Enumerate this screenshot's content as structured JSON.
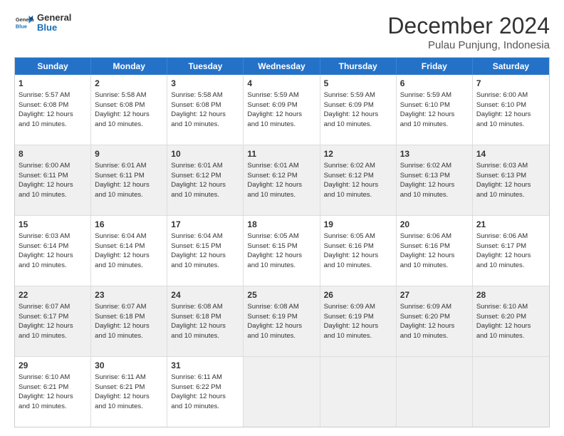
{
  "logo": {
    "line1": "General",
    "line2": "Blue"
  },
  "title": "December 2024",
  "subtitle": "Pulau Punjung, Indonesia",
  "days_of_week": [
    "Sunday",
    "Monday",
    "Tuesday",
    "Wednesday",
    "Thursday",
    "Friday",
    "Saturday"
  ],
  "rows": [
    [
      {
        "day": "1",
        "info": "Sunrise: 5:57 AM\nSunset: 6:08 PM\nDaylight: 12 hours\nand 10 minutes."
      },
      {
        "day": "2",
        "info": "Sunrise: 5:58 AM\nSunset: 6:08 PM\nDaylight: 12 hours\nand 10 minutes."
      },
      {
        "day": "3",
        "info": "Sunrise: 5:58 AM\nSunset: 6:08 PM\nDaylight: 12 hours\nand 10 minutes."
      },
      {
        "day": "4",
        "info": "Sunrise: 5:59 AM\nSunset: 6:09 PM\nDaylight: 12 hours\nand 10 minutes."
      },
      {
        "day": "5",
        "info": "Sunrise: 5:59 AM\nSunset: 6:09 PM\nDaylight: 12 hours\nand 10 minutes."
      },
      {
        "day": "6",
        "info": "Sunrise: 5:59 AM\nSunset: 6:10 PM\nDaylight: 12 hours\nand 10 minutes."
      },
      {
        "day": "7",
        "info": "Sunrise: 6:00 AM\nSunset: 6:10 PM\nDaylight: 12 hours\nand 10 minutes."
      }
    ],
    [
      {
        "day": "8",
        "info": "Sunrise: 6:00 AM\nSunset: 6:11 PM\nDaylight: 12 hours\nand 10 minutes."
      },
      {
        "day": "9",
        "info": "Sunrise: 6:01 AM\nSunset: 6:11 PM\nDaylight: 12 hours\nand 10 minutes."
      },
      {
        "day": "10",
        "info": "Sunrise: 6:01 AM\nSunset: 6:12 PM\nDaylight: 12 hours\nand 10 minutes."
      },
      {
        "day": "11",
        "info": "Sunrise: 6:01 AM\nSunset: 6:12 PM\nDaylight: 12 hours\nand 10 minutes."
      },
      {
        "day": "12",
        "info": "Sunrise: 6:02 AM\nSunset: 6:12 PM\nDaylight: 12 hours\nand 10 minutes."
      },
      {
        "day": "13",
        "info": "Sunrise: 6:02 AM\nSunset: 6:13 PM\nDaylight: 12 hours\nand 10 minutes."
      },
      {
        "day": "14",
        "info": "Sunrise: 6:03 AM\nSunset: 6:13 PM\nDaylight: 12 hours\nand 10 minutes."
      }
    ],
    [
      {
        "day": "15",
        "info": "Sunrise: 6:03 AM\nSunset: 6:14 PM\nDaylight: 12 hours\nand 10 minutes."
      },
      {
        "day": "16",
        "info": "Sunrise: 6:04 AM\nSunset: 6:14 PM\nDaylight: 12 hours\nand 10 minutes."
      },
      {
        "day": "17",
        "info": "Sunrise: 6:04 AM\nSunset: 6:15 PM\nDaylight: 12 hours\nand 10 minutes."
      },
      {
        "day": "18",
        "info": "Sunrise: 6:05 AM\nSunset: 6:15 PM\nDaylight: 12 hours\nand 10 minutes."
      },
      {
        "day": "19",
        "info": "Sunrise: 6:05 AM\nSunset: 6:16 PM\nDaylight: 12 hours\nand 10 minutes."
      },
      {
        "day": "20",
        "info": "Sunrise: 6:06 AM\nSunset: 6:16 PM\nDaylight: 12 hours\nand 10 minutes."
      },
      {
        "day": "21",
        "info": "Sunrise: 6:06 AM\nSunset: 6:17 PM\nDaylight: 12 hours\nand 10 minutes."
      }
    ],
    [
      {
        "day": "22",
        "info": "Sunrise: 6:07 AM\nSunset: 6:17 PM\nDaylight: 12 hours\nand 10 minutes."
      },
      {
        "day": "23",
        "info": "Sunrise: 6:07 AM\nSunset: 6:18 PM\nDaylight: 12 hours\nand 10 minutes."
      },
      {
        "day": "24",
        "info": "Sunrise: 6:08 AM\nSunset: 6:18 PM\nDaylight: 12 hours\nand 10 minutes."
      },
      {
        "day": "25",
        "info": "Sunrise: 6:08 AM\nSunset: 6:19 PM\nDaylight: 12 hours\nand 10 minutes."
      },
      {
        "day": "26",
        "info": "Sunrise: 6:09 AM\nSunset: 6:19 PM\nDaylight: 12 hours\nand 10 minutes."
      },
      {
        "day": "27",
        "info": "Sunrise: 6:09 AM\nSunset: 6:20 PM\nDaylight: 12 hours\nand 10 minutes."
      },
      {
        "day": "28",
        "info": "Sunrise: 6:10 AM\nSunset: 6:20 PM\nDaylight: 12 hours\nand 10 minutes."
      }
    ],
    [
      {
        "day": "29",
        "info": "Sunrise: 6:10 AM\nSunset: 6:21 PM\nDaylight: 12 hours\nand 10 minutes."
      },
      {
        "day": "30",
        "info": "Sunrise: 6:11 AM\nSunset: 6:21 PM\nDaylight: 12 hours\nand 10 minutes."
      },
      {
        "day": "31",
        "info": "Sunrise: 6:11 AM\nSunset: 6:22 PM\nDaylight: 12 hours\nand 10 minutes."
      },
      {
        "day": "",
        "info": ""
      },
      {
        "day": "",
        "info": ""
      },
      {
        "day": "",
        "info": ""
      },
      {
        "day": "",
        "info": ""
      }
    ]
  ]
}
